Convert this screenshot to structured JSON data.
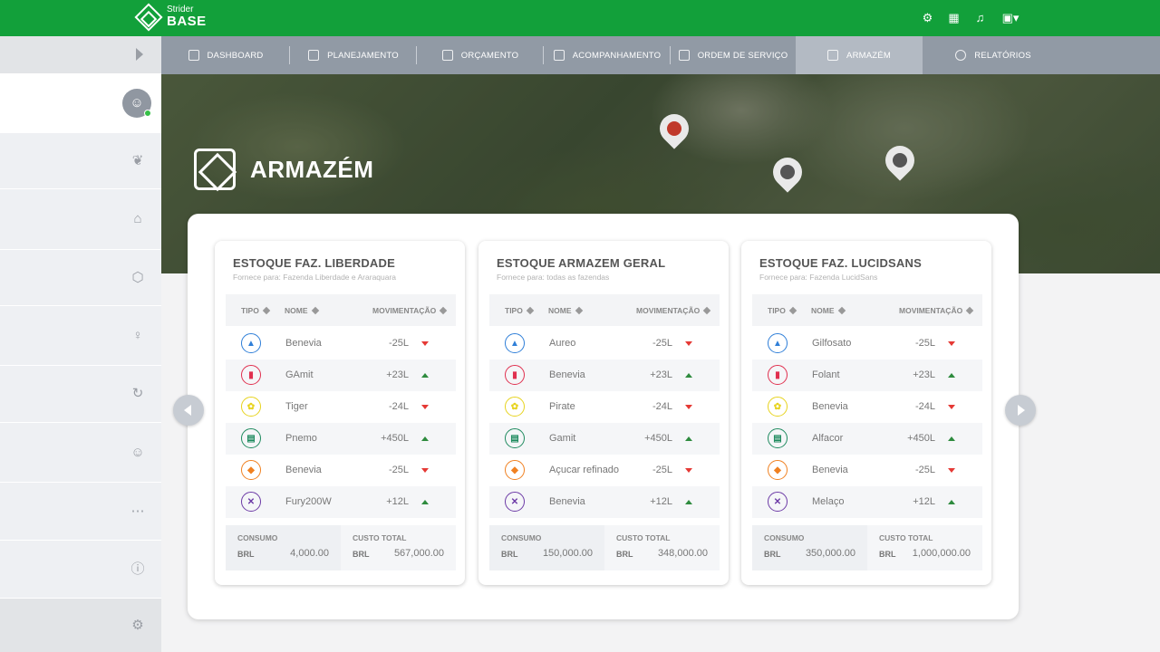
{
  "brand": {
    "small": "Strider",
    "big": "BASE"
  },
  "topbar": {
    "icons": [
      "gear-icon",
      "card-icon",
      "bell-icon",
      "user-icon"
    ]
  },
  "tabs": [
    {
      "label": "DASHBOARD",
      "icon": "dashboard-icon"
    },
    {
      "label": "PLANEJAMENTO",
      "icon": "planning-icon"
    },
    {
      "label": "ORÇAMENTO",
      "icon": "budget-icon"
    },
    {
      "label": "ACOMPANHAMENTO",
      "icon": "tracking-icon"
    },
    {
      "label": "ORDEM DE SERVIÇO",
      "icon": "service-order-icon"
    },
    {
      "label": "ARMAZÉM",
      "icon": "warehouse-icon",
      "active": true
    },
    {
      "label": "RELATÓRIOS",
      "icon": "reports-icon"
    }
  ],
  "hero": {
    "title": "ARMAZÉM"
  },
  "colors": {
    "brand_green": "#12a03a",
    "tab_bar": "#919aa5",
    "down": "#e53935",
    "up": "#2e8b3e"
  },
  "cards": [
    {
      "title": "ESTOQUE FAZ. LIBERDADE",
      "subtitle": "Fornece para: Fazenda Liberdade e Araraquara",
      "headers": {
        "tipo": "TIPO",
        "nome": "NOME",
        "mov": "MOVIMENTAÇÃO"
      },
      "rows": [
        {
          "name": "Benevia",
          "value": "-25L",
          "dir": "down"
        },
        {
          "name": "GAmit",
          "value": "+23L",
          "dir": "up"
        },
        {
          "name": "Tiger",
          "value": "-24L",
          "dir": "down"
        },
        {
          "name": "Pnemo",
          "value": "+450L",
          "dir": "up"
        },
        {
          "name": "Benevia",
          "value": "-25L",
          "dir": "down"
        },
        {
          "name": "Fury200W",
          "value": "+12L",
          "dir": "up"
        }
      ],
      "consumo": {
        "label": "CONSUMO",
        "currency": "BRL",
        "value": "4,000.00"
      },
      "custo": {
        "label": "CUSTO TOTAL",
        "currency": "BRL",
        "value": "567,000.00"
      }
    },
    {
      "title": "ESTOQUE ARMAZEM GERAL",
      "subtitle": "Fornece para: todas as fazendas",
      "headers": {
        "tipo": "TIPO",
        "nome": "NOME",
        "mov": "MOVIMENTAÇÃO"
      },
      "rows": [
        {
          "name": "Aureo",
          "value": "-25L",
          "dir": "down"
        },
        {
          "name": "Benevia",
          "value": "+23L",
          "dir": "up"
        },
        {
          "name": "Pirate",
          "value": "-24L",
          "dir": "down"
        },
        {
          "name": "Gamit",
          "value": "+450L",
          "dir": "up"
        },
        {
          "name": "Açucar refinado",
          "value": "-25L",
          "dir": "down"
        },
        {
          "name": "Benevia",
          "value": "+12L",
          "dir": "up"
        }
      ],
      "consumo": {
        "label": "CONSUMO",
        "currency": "BRL",
        "value": "150,000.00"
      },
      "custo": {
        "label": "CUSTO TOTAL",
        "currency": "BRL",
        "value": "348,000.00"
      }
    },
    {
      "title": "ESTOQUE FAZ. LUCIDSANS",
      "subtitle": "Fornece para: Fazenda LucidSans",
      "headers": {
        "tipo": "TIPO",
        "nome": "NOME",
        "mov": "MOVIMENTAÇÃO"
      },
      "rows": [
        {
          "name": "Gilfosato",
          "value": "-25L",
          "dir": "down"
        },
        {
          "name": "Folant",
          "value": "+23L",
          "dir": "up"
        },
        {
          "name": "Benevia",
          "value": "-24L",
          "dir": "down"
        },
        {
          "name": "Alfacor",
          "value": "+450L",
          "dir": "up"
        },
        {
          "name": "Benevia",
          "value": "-25L",
          "dir": "down"
        },
        {
          "name": "Melaço",
          "value": "+12L",
          "dir": "up"
        }
      ],
      "consumo": {
        "label": "CONSUMO",
        "currency": "BRL",
        "value": "350,000.00"
      },
      "custo": {
        "label": "CUSTO TOTAL",
        "currency": "BRL",
        "value": "1,000,000.00"
      }
    }
  ],
  "row_types": [
    {
      "icon": "bottle-blue-icon",
      "color": "#2f7fd8",
      "glyph": "▲"
    },
    {
      "icon": "bottle-red-icon",
      "color": "#e0304f",
      "glyph": "▮"
    },
    {
      "icon": "plant-yellow-icon",
      "color": "#e7d31e",
      "glyph": "✿"
    },
    {
      "icon": "container-green-icon",
      "color": "#1e8a5e",
      "glyph": "▤"
    },
    {
      "icon": "flask-orange-icon",
      "color": "#f08020",
      "glyph": "◆"
    },
    {
      "icon": "tools-purple-icon",
      "color": "#6c3aa6",
      "glyph": "✕"
    }
  ]
}
